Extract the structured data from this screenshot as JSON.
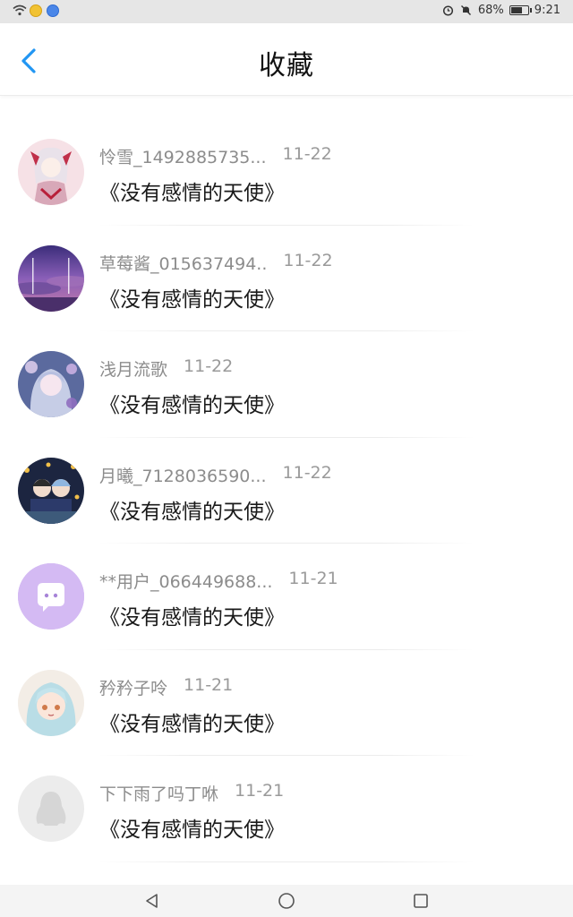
{
  "status_bar": {
    "battery_text": "68%",
    "battery_level": 0.68,
    "time": "9:21",
    "icons_left": [
      "wifi-icon",
      "app-notification-icon",
      "browser-app-icon"
    ],
    "icons_right": [
      "alarm-icon",
      "mute-icon",
      "battery-icon"
    ]
  },
  "header": {
    "title": "收藏",
    "back_icon": "chevron-left-icon",
    "accent_color": "#2196f3"
  },
  "favorites": [
    {
      "username": "怜雪_1492885735...",
      "date": "11-22",
      "title": "《没有感情的天使》",
      "avatar": "avatar-anime-girl-red"
    },
    {
      "username": "草莓酱_015637494..",
      "date": "11-22",
      "title": "《没有感情的天使》",
      "avatar": "avatar-purple-sky"
    },
    {
      "username": "浅月流歌",
      "date": "11-22",
      "title": "《没有感情的天使》",
      "avatar": "avatar-anime-girl-blue"
    },
    {
      "username": "月曦_7128036590...",
      "date": "11-22",
      "title": "《没有感情的天使》",
      "avatar": "avatar-night-lanterns"
    },
    {
      "username": "**用户_066449688...",
      "date": "11-21",
      "title": "《没有感情的天使》",
      "avatar": "avatar-chat-bubble"
    },
    {
      "username": "矜矜子呤",
      "date": "11-21",
      "title": "《没有感情的天使》",
      "avatar": "avatar-anime-girl-silver"
    },
    {
      "username": "下下雨了吗丁咻",
      "date": "11-21",
      "title": "《没有感情的天使》",
      "avatar": "avatar-default-penguin"
    }
  ],
  "nav_bar": {
    "buttons": [
      "back-triangle-icon",
      "home-circle-icon",
      "recents-square-icon"
    ]
  }
}
